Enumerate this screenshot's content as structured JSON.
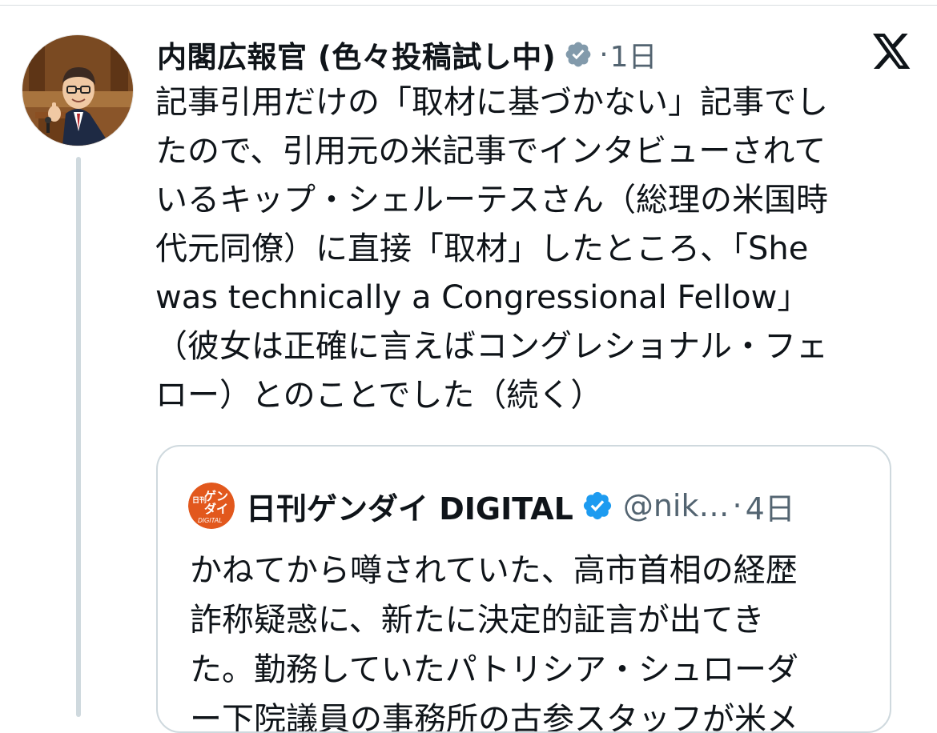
{
  "post": {
    "display_name": "内閣広報官 (色々投稿試し中)",
    "dot": "·",
    "time": "1日",
    "text_lines": [
      "記事引用だけの「取材に基づかない」記事でし",
      "たので、引用元の米記事でインタビューされて",
      "いるキップ・シェルーテスさん（総理の米国時",
      "代元同僚）に直接「取材」したところ、「She",
      "was technically a Congressional Fellow」",
      "（彼女は正確に言えばコングレショナル・フェ",
      "ロー）とのことでした（続く）"
    ],
    "icons": {
      "verified": "verified-gray-icon",
      "platform": "x-logo-icon"
    }
  },
  "quote": {
    "display_name": "日刊ゲンダイ DIGITAL",
    "handle": "@nik…",
    "dot": "·",
    "time": "4日",
    "avatar_text": {
      "line1": "日刊",
      "line2": "ゲン",
      "line3": "ダイ",
      "line4": "DIGITAL"
    },
    "text_lines": [
      "かねてから噂されていた、高市首相の経歴",
      "詐称疑惑に、新たに決定的証言が出てき",
      "た。勤務していたパトリシア・シュローダ",
      "ー下院議員の事務所の古参スタッフが米メ"
    ],
    "icons": {
      "verified": "verified-blue-icon"
    }
  },
  "colors": {
    "text_primary": "#0f1419",
    "text_secondary": "#536471",
    "verified_blue": "#1d9bf0",
    "verified_gray": "#829aab",
    "border": "#cfd9de",
    "gendai_orange": "#e2581d"
  }
}
